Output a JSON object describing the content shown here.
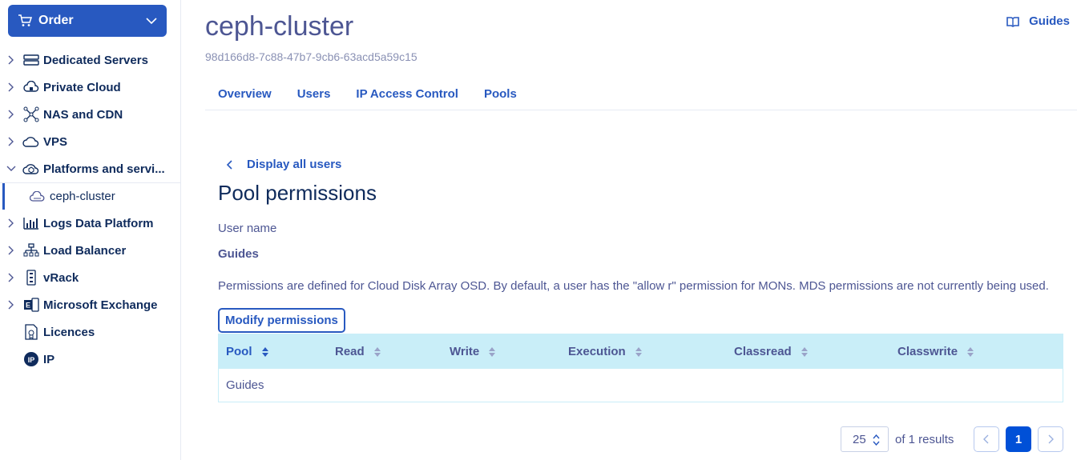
{
  "sidebar": {
    "order_label": "Order",
    "items": [
      {
        "label": "Dedicated Servers"
      },
      {
        "label": "Private Cloud"
      },
      {
        "label": "NAS and CDN"
      },
      {
        "label": "VPS"
      },
      {
        "label": "Platforms and servi..."
      },
      {
        "label": "ceph-cluster"
      },
      {
        "label": "Logs Data Platform"
      },
      {
        "label": "Load Balancer"
      },
      {
        "label": "vRack"
      },
      {
        "label": "Microsoft Exchange"
      },
      {
        "label": "Licences"
      },
      {
        "label": "IP"
      }
    ]
  },
  "header": {
    "title": "ceph-cluster",
    "uuid": "98d166d8-7c88-47b7-9cb6-63acd5a59c15",
    "guides_label": "Guides"
  },
  "tabs": [
    "Overview",
    "Users",
    "IP Access Control",
    "Pools"
  ],
  "content": {
    "back_label": "Display all users",
    "heading": "Pool permissions",
    "user_label": "User name",
    "user_value": "Guides",
    "description": "Permissions are defined for Cloud Disk Array OSD. By default, a user has the \"allow r\" permission for MONs. MDS permissions are not currently being used.",
    "modify_label": "Modify permissions"
  },
  "table": {
    "columns": [
      "Pool",
      "Read",
      "Write",
      "Execution",
      "Classread",
      "Classwrite"
    ],
    "rows": [
      [
        "Guides",
        "",
        "",
        "",
        "",
        ""
      ]
    ]
  },
  "pagination": {
    "per_page": "25",
    "results_text": "of 1 results",
    "current_page": "1"
  },
  "colors": {
    "accent": "#2859c0",
    "table_header_bg": "#c9eef8",
    "text": "#4d5693",
    "nav_text": "#0f2b5c"
  }
}
